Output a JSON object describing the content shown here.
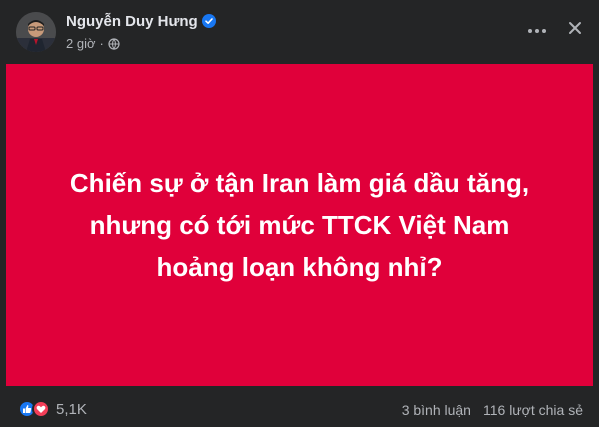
{
  "post": {
    "author": "Nguyễn Duy Hưng",
    "time": "2 giờ",
    "separator": "·",
    "card_text_lines": [
      "Chiến sự ở tận Iran làm giá dầu tăng,",
      "nhưng có tới mức TTCK Việt Nam",
      "hoảng loạn không nhỉ?"
    ],
    "card_color": "#e0003a"
  },
  "icons": {
    "verified": "verified-badge-icon",
    "globe": "globe-icon",
    "more": "more-options-icon",
    "close": "close-icon",
    "like": "like-reaction-icon",
    "love": "love-reaction-icon"
  },
  "footer": {
    "reaction_count": "5,1K",
    "comments": "3 bình luận",
    "shares": "116 lượt chia sẻ"
  }
}
